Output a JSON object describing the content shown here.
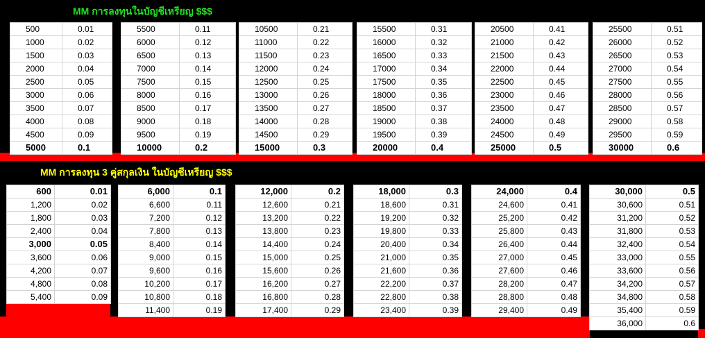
{
  "section1": {
    "title": "MM การลงทุนในบัญชีเหรียญ $$$",
    "tables": [
      {
        "rows": [
          [
            "500",
            "0.01"
          ],
          [
            "1000",
            "0.02"
          ],
          [
            "1500",
            "0.03"
          ],
          [
            "2000",
            "0.04"
          ],
          [
            "2500",
            "0.05"
          ],
          [
            "3000",
            "0.06"
          ],
          [
            "3500",
            "0.07"
          ],
          [
            "4000",
            "0.08"
          ],
          [
            "4500",
            "0.09"
          ],
          [
            "5000",
            "0.1"
          ]
        ]
      },
      {
        "rows": [
          [
            "5500",
            "0.11"
          ],
          [
            "6000",
            "0.12"
          ],
          [
            "6500",
            "0.13"
          ],
          [
            "7000",
            "0.14"
          ],
          [
            "7500",
            "0.15"
          ],
          [
            "8000",
            "0.16"
          ],
          [
            "8500",
            "0.17"
          ],
          [
            "9000",
            "0.18"
          ],
          [
            "9500",
            "0.19"
          ],
          [
            "10000",
            "0.2"
          ]
        ]
      },
      {
        "rows": [
          [
            "10500",
            "0.21"
          ],
          [
            "11000",
            "0.22"
          ],
          [
            "11500",
            "0.23"
          ],
          [
            "12000",
            "0.24"
          ],
          [
            "12500",
            "0.25"
          ],
          [
            "13000",
            "0.26"
          ],
          [
            "13500",
            "0.27"
          ],
          [
            "14000",
            "0.28"
          ],
          [
            "14500",
            "0.29"
          ],
          [
            "15000",
            "0.3"
          ]
        ]
      },
      {
        "rows": [
          [
            "15500",
            "0.31"
          ],
          [
            "16000",
            "0.32"
          ],
          [
            "16500",
            "0.33"
          ],
          [
            "17000",
            "0.34"
          ],
          [
            "17500",
            "0.35"
          ],
          [
            "18000",
            "0.36"
          ],
          [
            "18500",
            "0.37"
          ],
          [
            "19000",
            "0.38"
          ],
          [
            "19500",
            "0.39"
          ],
          [
            "20000",
            "0.4"
          ]
        ]
      },
      {
        "rows": [
          [
            "20500",
            "0.41"
          ],
          [
            "21000",
            "0.42"
          ],
          [
            "21500",
            "0.43"
          ],
          [
            "22000",
            "0.44"
          ],
          [
            "22500",
            "0.45"
          ],
          [
            "23000",
            "0.46"
          ],
          [
            "23500",
            "0.47"
          ],
          [
            "24000",
            "0.48"
          ],
          [
            "24500",
            "0.49"
          ],
          [
            "25000",
            "0.5"
          ]
        ]
      },
      {
        "rows": [
          [
            "25500",
            "0.51"
          ],
          [
            "26000",
            "0.52"
          ],
          [
            "26500",
            "0.53"
          ],
          [
            "27000",
            "0.54"
          ],
          [
            "27500",
            "0.55"
          ],
          [
            "28000",
            "0.56"
          ],
          [
            "28500",
            "0.57"
          ],
          [
            "29000",
            "0.58"
          ],
          [
            "29500",
            "0.59"
          ],
          [
            "30000",
            "0.6"
          ]
        ]
      }
    ]
  },
  "section2": {
    "title": "MM การลงทุน 3 คู่สกุลเงิน  ในบัญชีเหรียญ $$$",
    "tables": [
      {
        "rows": [
          [
            "600",
            "0.01"
          ],
          [
            "1,200",
            "0.02"
          ],
          [
            "1,800",
            "0.03"
          ],
          [
            "2,400",
            "0.04"
          ],
          [
            "3,000",
            "0.05"
          ],
          [
            "3,600",
            "0.06"
          ],
          [
            "4,200",
            "0.07"
          ],
          [
            "4,800",
            "0.08"
          ],
          [
            "5,400",
            "0.09"
          ]
        ]
      },
      {
        "rows": [
          [
            "6,000",
            "0.1"
          ],
          [
            "6,600",
            "0.11"
          ],
          [
            "7,200",
            "0.12"
          ],
          [
            "7,800",
            "0.13"
          ],
          [
            "8,400",
            "0.14"
          ],
          [
            "9,000",
            "0.15"
          ],
          [
            "9,600",
            "0.16"
          ],
          [
            "10,200",
            "0.17"
          ],
          [
            "10,800",
            "0.18"
          ],
          [
            "11,400",
            "0.19"
          ]
        ]
      },
      {
        "rows": [
          [
            "12,000",
            "0.2"
          ],
          [
            "12,600",
            "0.21"
          ],
          [
            "13,200",
            "0.22"
          ],
          [
            "13,800",
            "0.23"
          ],
          [
            "14,400",
            "0.24"
          ],
          [
            "15,000",
            "0.25"
          ],
          [
            "15,600",
            "0.26"
          ],
          [
            "16,200",
            "0.27"
          ],
          [
            "16,800",
            "0.28"
          ],
          [
            "17,400",
            "0.29"
          ]
        ]
      },
      {
        "rows": [
          [
            "18,000",
            "0.3"
          ],
          [
            "18,600",
            "0.31"
          ],
          [
            "19,200",
            "0.32"
          ],
          [
            "19,800",
            "0.33"
          ],
          [
            "20,400",
            "0.34"
          ],
          [
            "21,000",
            "0.35"
          ],
          [
            "21,600",
            "0.36"
          ],
          [
            "22,200",
            "0.37"
          ],
          [
            "22,800",
            "0.38"
          ],
          [
            "23,400",
            "0.39"
          ]
        ]
      },
      {
        "rows": [
          [
            "24,000",
            "0.4"
          ],
          [
            "24,600",
            "0.41"
          ],
          [
            "25,200",
            "0.42"
          ],
          [
            "25,800",
            "0.43"
          ],
          [
            "26,400",
            "0.44"
          ],
          [
            "27,000",
            "0.45"
          ],
          [
            "27,600",
            "0.46"
          ],
          [
            "28,200",
            "0.47"
          ],
          [
            "28,800",
            "0.48"
          ],
          [
            "29,400",
            "0.49"
          ]
        ]
      },
      {
        "rows": [
          [
            "30,000",
            "0.5"
          ],
          [
            "30,600",
            "0.51"
          ],
          [
            "31,200",
            "0.52"
          ],
          [
            "31,800",
            "0.53"
          ],
          [
            "32,400",
            "0.54"
          ],
          [
            "33,000",
            "0.55"
          ],
          [
            "33,600",
            "0.56"
          ],
          [
            "34,200",
            "0.57"
          ],
          [
            "34,800",
            "0.58"
          ],
          [
            "35,400",
            "0.59"
          ],
          [
            "36,000",
            "0.6"
          ]
        ]
      }
    ]
  }
}
